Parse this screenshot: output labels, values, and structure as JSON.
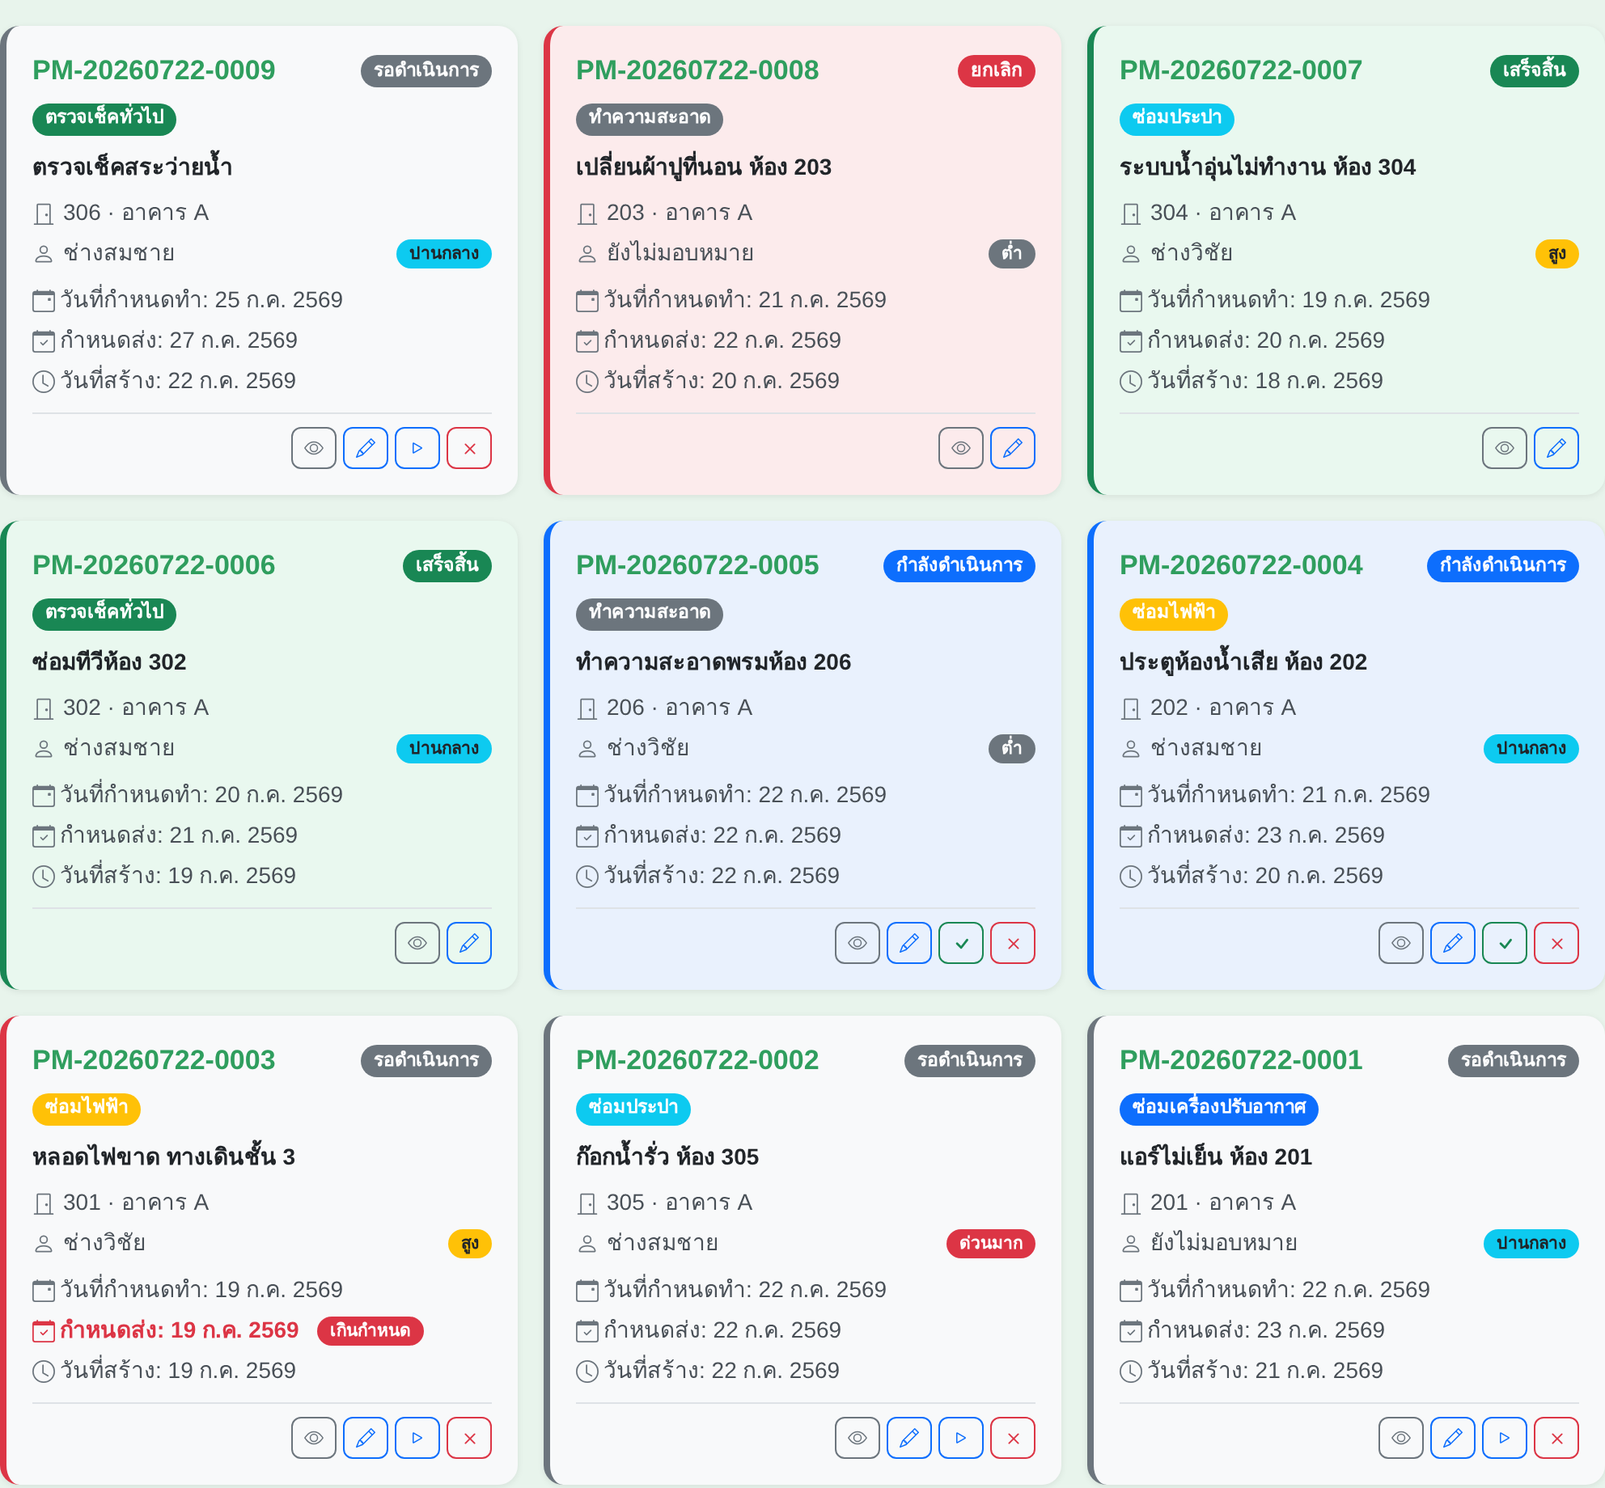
{
  "cards": [
    {
      "id": "PM-20260722-0009",
      "status": {
        "label": "รอดำเนินการ",
        "kind": "pending"
      },
      "category": {
        "label": "ตรวจเช็คทั่วไป",
        "color": "#198754"
      },
      "title": "ตรวจเช็คสระว่ายน้ำ",
      "room": "306 · อาคาร A",
      "assignee": "ช่างสมชาย",
      "priority": {
        "label": "ปานกลาง",
        "kind": "medium"
      },
      "dates": [
        {
          "kind": "scheduled",
          "text": "วันที่กำหนดทำ: 25 ก.ค. 2569"
        },
        {
          "kind": "due",
          "text": "กำหนดส่ง: 27 ก.ค. 2569",
          "overdue": false
        },
        {
          "kind": "created",
          "text": "วันที่สร้าง: 22 ก.ค. 2569"
        }
      ],
      "actions": [
        {
          "kind": "view"
        },
        {
          "kind": "edit"
        },
        {
          "kind": "start"
        },
        {
          "kind": "cancel"
        }
      ]
    },
    {
      "id": "PM-20260722-0008",
      "status": {
        "label": "ยกเลิก",
        "kind": "cancelled"
      },
      "category": {
        "label": "ทำความสะอาด",
        "color": "#6c757d"
      },
      "title": "เปลี่ยนผ้าปูที่นอน ห้อง 203",
      "room": "203 · อาคาร A",
      "assignee": "ยังไม่มอบหมาย",
      "priority": {
        "label": "ต่ำ",
        "kind": "low"
      },
      "dates": [
        {
          "kind": "scheduled",
          "text": "วันที่กำหนดทำ: 21 ก.ค. 2569"
        },
        {
          "kind": "due",
          "text": "กำหนดส่ง: 22 ก.ค. 2569",
          "overdue": false
        },
        {
          "kind": "created",
          "text": "วันที่สร้าง: 20 ก.ค. 2569"
        }
      ],
      "actions": [
        {
          "kind": "view"
        },
        {
          "kind": "edit"
        }
      ]
    },
    {
      "id": "PM-20260722-0007",
      "status": {
        "label": "เสร็จสิ้น",
        "kind": "completed"
      },
      "category": {
        "label": "ซ่อมประปา",
        "color": "#0dcaf0"
      },
      "title": "ระบบน้ำอุ่นไม่ทำงาน ห้อง 304",
      "room": "304 · อาคาร A",
      "assignee": "ช่างวิชัย",
      "priority": {
        "label": "สูง",
        "kind": "high"
      },
      "dates": [
        {
          "kind": "scheduled",
          "text": "วันที่กำหนดทำ: 19 ก.ค. 2569"
        },
        {
          "kind": "due",
          "text": "กำหนดส่ง: 20 ก.ค. 2569",
          "overdue": false
        },
        {
          "kind": "created",
          "text": "วันที่สร้าง: 18 ก.ค. 2569"
        }
      ],
      "actions": [
        {
          "kind": "view"
        },
        {
          "kind": "edit"
        }
      ]
    },
    {
      "id": "PM-20260722-0006",
      "status": {
        "label": "เสร็จสิ้น",
        "kind": "completed"
      },
      "category": {
        "label": "ตรวจเช็คทั่วไป",
        "color": "#198754"
      },
      "title": "ซ่อมทีวีห้อง 302",
      "room": "302 · อาคาร A",
      "assignee": "ช่างสมชาย",
      "priority": {
        "label": "ปานกลาง",
        "kind": "medium"
      },
      "dates": [
        {
          "kind": "scheduled",
          "text": "วันที่กำหนดทำ: 20 ก.ค. 2569"
        },
        {
          "kind": "due",
          "text": "กำหนดส่ง: 21 ก.ค. 2569",
          "overdue": false
        },
        {
          "kind": "created",
          "text": "วันที่สร้าง: 19 ก.ค. 2569"
        }
      ],
      "actions": [
        {
          "kind": "view"
        },
        {
          "kind": "edit"
        }
      ]
    },
    {
      "id": "PM-20260722-0005",
      "status": {
        "label": "กำลังดำเนินการ",
        "kind": "in_progress"
      },
      "category": {
        "label": "ทำความสะอาด",
        "color": "#6c757d"
      },
      "title": "ทำความสะอาดพรมห้อง 206",
      "room": "206 · อาคาร A",
      "assignee": "ช่างวิชัย",
      "priority": {
        "label": "ต่ำ",
        "kind": "low"
      },
      "dates": [
        {
          "kind": "scheduled",
          "text": "วันที่กำหนดทำ: 22 ก.ค. 2569"
        },
        {
          "kind": "due",
          "text": "กำหนดส่ง: 22 ก.ค. 2569",
          "overdue": false
        },
        {
          "kind": "created",
          "text": "วันที่สร้าง: 22 ก.ค. 2569"
        }
      ],
      "actions": [
        {
          "kind": "view"
        },
        {
          "kind": "edit"
        },
        {
          "kind": "complete"
        },
        {
          "kind": "cancel"
        }
      ]
    },
    {
      "id": "PM-20260722-0004",
      "status": {
        "label": "กำลังดำเนินการ",
        "kind": "in_progress"
      },
      "category": {
        "label": "ซ่อมไฟฟ้า",
        "color": "#ffc107"
      },
      "title": "ประตูห้องน้ำเสีย ห้อง 202",
      "room": "202 · อาคาร A",
      "assignee": "ช่างสมชาย",
      "priority": {
        "label": "ปานกลาง",
        "kind": "medium"
      },
      "dates": [
        {
          "kind": "scheduled",
          "text": "วันที่กำหนดทำ: 21 ก.ค. 2569"
        },
        {
          "kind": "due",
          "text": "กำหนดส่ง: 23 ก.ค. 2569",
          "overdue": false
        },
        {
          "kind": "created",
          "text": "วันที่สร้าง: 20 ก.ค. 2569"
        }
      ],
      "actions": [
        {
          "kind": "view"
        },
        {
          "kind": "edit"
        },
        {
          "kind": "complete"
        },
        {
          "kind": "cancel"
        }
      ]
    },
    {
      "id": "PM-20260722-0003",
      "status": {
        "label": "รอดำเนินการ",
        "kind": "pending"
      },
      "category": {
        "label": "ซ่อมไฟฟ้า",
        "color": "#ffc107"
      },
      "title": "หลอดไฟขาด ทางเดินชั้น 3",
      "room": "301 · อาคาร A",
      "assignee": "ช่างวิชัย",
      "priority": {
        "label": "สูง",
        "kind": "high"
      },
      "dates": [
        {
          "kind": "scheduled",
          "text": "วันที่กำหนดทำ: 19 ก.ค. 2569"
        },
        {
          "kind": "due",
          "text": "กำหนดส่ง: 19 ก.ค. 2569",
          "overdue": true,
          "badge": "เกินกำหนด"
        },
        {
          "kind": "created",
          "text": "วันที่สร้าง: 19 ก.ค. 2569"
        }
      ],
      "actions": [
        {
          "kind": "view"
        },
        {
          "kind": "edit"
        },
        {
          "kind": "start"
        },
        {
          "kind": "cancel"
        }
      ]
    },
    {
      "id": "PM-20260722-0002",
      "status": {
        "label": "รอดำเนินการ",
        "kind": "pending"
      },
      "category": {
        "label": "ซ่อมประปา",
        "color": "#0dcaf0"
      },
      "title": "ก๊อกน้ำรั่ว ห้อง 305",
      "room": "305 · อาคาร A",
      "assignee": "ช่างสมชาย",
      "priority": {
        "label": "ด่วนมาก",
        "kind": "urgent"
      },
      "dates": [
        {
          "kind": "scheduled",
          "text": "วันที่กำหนดทำ: 22 ก.ค. 2569"
        },
        {
          "kind": "due",
          "text": "กำหนดส่ง: 22 ก.ค. 2569",
          "overdue": false
        },
        {
          "kind": "created",
          "text": "วันที่สร้าง: 22 ก.ค. 2569"
        }
      ],
      "actions": [
        {
          "kind": "view"
        },
        {
          "kind": "edit"
        },
        {
          "kind": "start"
        },
        {
          "kind": "cancel"
        }
      ]
    },
    {
      "id": "PM-20260722-0001",
      "status": {
        "label": "รอดำเนินการ",
        "kind": "pending"
      },
      "category": {
        "label": "ซ่อมเครื่องปรับอากาศ",
        "color": "#0d6efd"
      },
      "title": "แอร์ไม่เย็น ห้อง 201",
      "room": "201 · อาคาร A",
      "assignee": "ยังไม่มอบหมาย",
      "priority": {
        "label": "ปานกลาง",
        "kind": "medium"
      },
      "dates": [
        {
          "kind": "scheduled",
          "text": "วันที่กำหนดทำ: 22 ก.ค. 2569"
        },
        {
          "kind": "due",
          "text": "กำหนดส่ง: 23 ก.ค. 2569",
          "overdue": false
        },
        {
          "kind": "created",
          "text": "วันที่สร้าง: 21 ก.ค. 2569"
        }
      ],
      "actions": [
        {
          "kind": "view"
        },
        {
          "kind": "edit"
        },
        {
          "kind": "start"
        },
        {
          "kind": "cancel"
        }
      ]
    }
  ]
}
